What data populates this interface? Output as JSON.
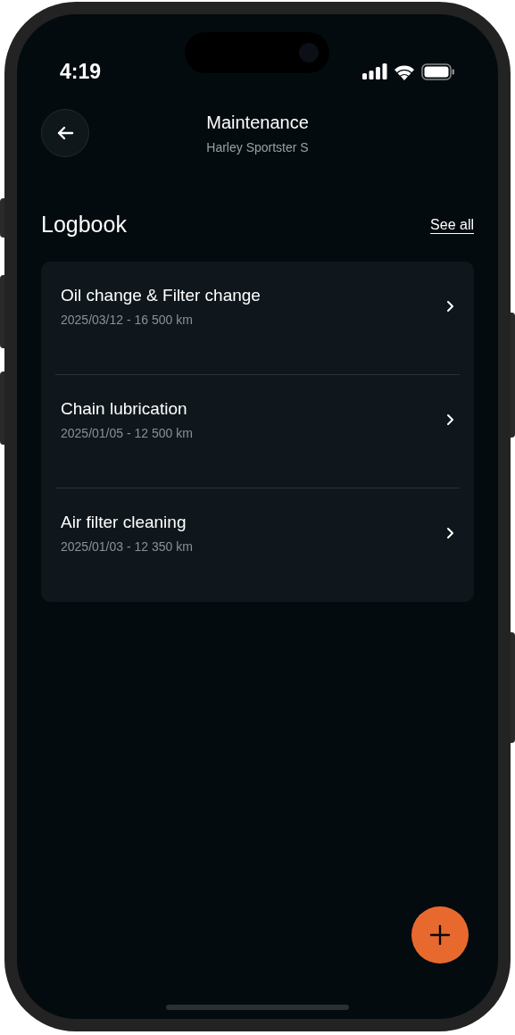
{
  "status_bar": {
    "time": "4:19"
  },
  "header": {
    "title": "Maintenance",
    "subtitle": "Harley Sportster S"
  },
  "section": {
    "title": "Logbook",
    "link": "See all"
  },
  "entries": [
    {
      "title": "Oil change & Filter change",
      "detail": "2025/03/12 - 16 500 km"
    },
    {
      "title": "Chain lubrication",
      "detail": "2025/01/05 - 12 500 km"
    },
    {
      "title": "Air filter cleaning",
      "detail": "2025/01/03 - 12 350 km"
    }
  ]
}
